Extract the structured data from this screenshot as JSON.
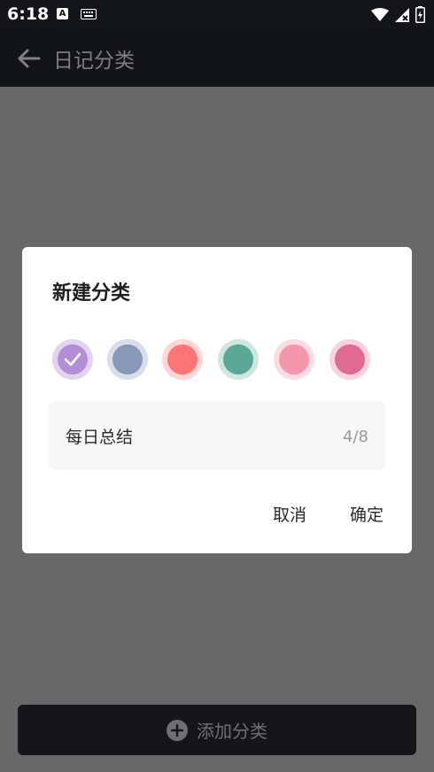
{
  "status": {
    "time": "6:18",
    "notif_letter": "A"
  },
  "header": {
    "title": "日记分类"
  },
  "dialog": {
    "title": "新建分类",
    "colors": [
      {
        "fill": "#b18ed6",
        "ring": "#e2d4f1",
        "selected": true
      },
      {
        "fill": "#8798b8",
        "ring": "#d9dee8",
        "selected": false
      },
      {
        "fill": "#ff7474",
        "ring": "#ffd5d5",
        "selected": false
      },
      {
        "fill": "#5ca897",
        "ring": "#cfe6e0",
        "selected": false
      },
      {
        "fill": "#f696ad",
        "ring": "#fcdce4",
        "selected": false
      },
      {
        "fill": "#e06a91",
        "ring": "#f6d3de",
        "selected": false
      }
    ],
    "name_value": "每日总结",
    "counter": "4/8",
    "cancel_label": "取消",
    "confirm_label": "确定"
  },
  "footer": {
    "add_label": "添加分类"
  }
}
